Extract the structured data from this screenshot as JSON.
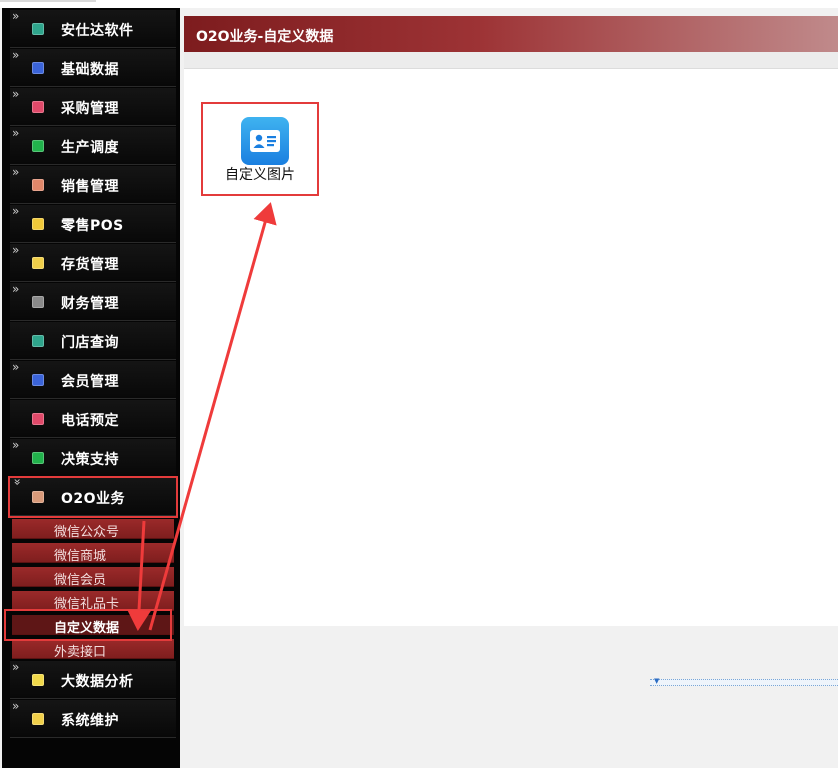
{
  "sidebar": {
    "items": [
      {
        "label": "安仕达软件",
        "icon": "app-icon",
        "color": "#2fa58c",
        "chevron": "»"
      },
      {
        "label": "基础数据",
        "icon": "database-icon",
        "color": "#3b64d9",
        "chevron": "»"
      },
      {
        "label": "采购管理",
        "icon": "purchase-icon",
        "color": "#e04a6a",
        "chevron": "»"
      },
      {
        "label": "生产调度",
        "icon": "production-icon",
        "color": "#22b24c",
        "chevron": "»"
      },
      {
        "label": "销售管理",
        "icon": "sales-icon",
        "color": "#e0876a",
        "chevron": "»"
      },
      {
        "label": "零售POS",
        "icon": "pos-icon",
        "color": "#f0c93a",
        "chevron": "»"
      },
      {
        "label": "存货管理",
        "icon": "inventory-icon",
        "color": "#f0cf4a",
        "chevron": "»"
      },
      {
        "label": "财务管理",
        "icon": "finance-icon",
        "color": "#8a8a8a",
        "chevron": "»"
      },
      {
        "label": "门店查询",
        "icon": "store-icon",
        "color": "#2fa58c",
        "chevron": ""
      },
      {
        "label": "会员管理",
        "icon": "member-icon",
        "color": "#3b64d9",
        "chevron": "»"
      },
      {
        "label": "电话预定",
        "icon": "phone-icon",
        "color": "#e04a6a",
        "chevron": ""
      },
      {
        "label": "决策支持",
        "icon": "decision-icon",
        "color": "#22b24c",
        "chevron": "»"
      },
      {
        "label": "O2O业务",
        "icon": "o2o-icon",
        "color": "#d89a7a",
        "chevron": "»"
      },
      {
        "label": "大数据分析",
        "icon": "bigdata-icon",
        "color": "#f0d84a",
        "chevron": "»"
      },
      {
        "label": "系统维护",
        "icon": "system-icon",
        "color": "#f0cf4a",
        "chevron": "»"
      }
    ],
    "o2o_sub": [
      {
        "label": "微信公众号"
      },
      {
        "label": "微信商城"
      },
      {
        "label": "微信会员"
      },
      {
        "label": "微信礼品卡"
      },
      {
        "label": "自定义数据"
      },
      {
        "label": "外卖接口"
      }
    ]
  },
  "main": {
    "title": "O2O业务-自定义数据",
    "app": {
      "label": "自定义图片",
      "icon": "contact-card-icon"
    }
  },
  "colors": {
    "accent": "#e33b3b",
    "title_bar": "#7d1c1e",
    "sub_menu": "#8a2424"
  }
}
